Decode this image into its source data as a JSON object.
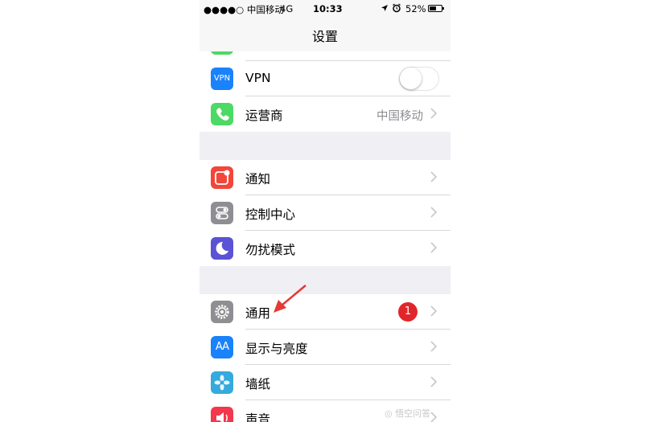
{
  "status_bar": {
    "carrier": "●●●●○ 中国移动",
    "network": "4G",
    "time": "10:33",
    "battery_pct": "52%"
  },
  "nav": {
    "title": "设置"
  },
  "sections": [
    {
      "items": [
        {
          "label": "VPN",
          "icon": "vpn-icon",
          "icon_text": "VPN",
          "color": "#1a82fb",
          "toggle": "off"
        },
        {
          "label": "运营商",
          "icon": "phone-icon",
          "color": "#4cd964",
          "detail": "中国移动"
        }
      ]
    },
    {
      "items": [
        {
          "label": "通知",
          "icon": "notifications-icon",
          "color": "#f2463a"
        },
        {
          "label": "控制中心",
          "icon": "control-center-icon",
          "color": "#8e8e93"
        },
        {
          "label": "勿扰模式",
          "icon": "moon-icon",
          "color": "#5b52d6"
        }
      ]
    },
    {
      "items": [
        {
          "label": "通用",
          "icon": "gear-icon",
          "color": "#8e8e93",
          "badge": "1"
        },
        {
          "label": "显示与亮度",
          "icon": "display-icon",
          "icon_text": "AA",
          "color": "#1a82fb"
        },
        {
          "label": "墙纸",
          "icon": "wallpaper-icon",
          "color": "#35aadc"
        },
        {
          "label": "声音",
          "icon": "sound-icon",
          "color": "#f2384c"
        }
      ]
    }
  ],
  "annotation_color": "#e53935"
}
